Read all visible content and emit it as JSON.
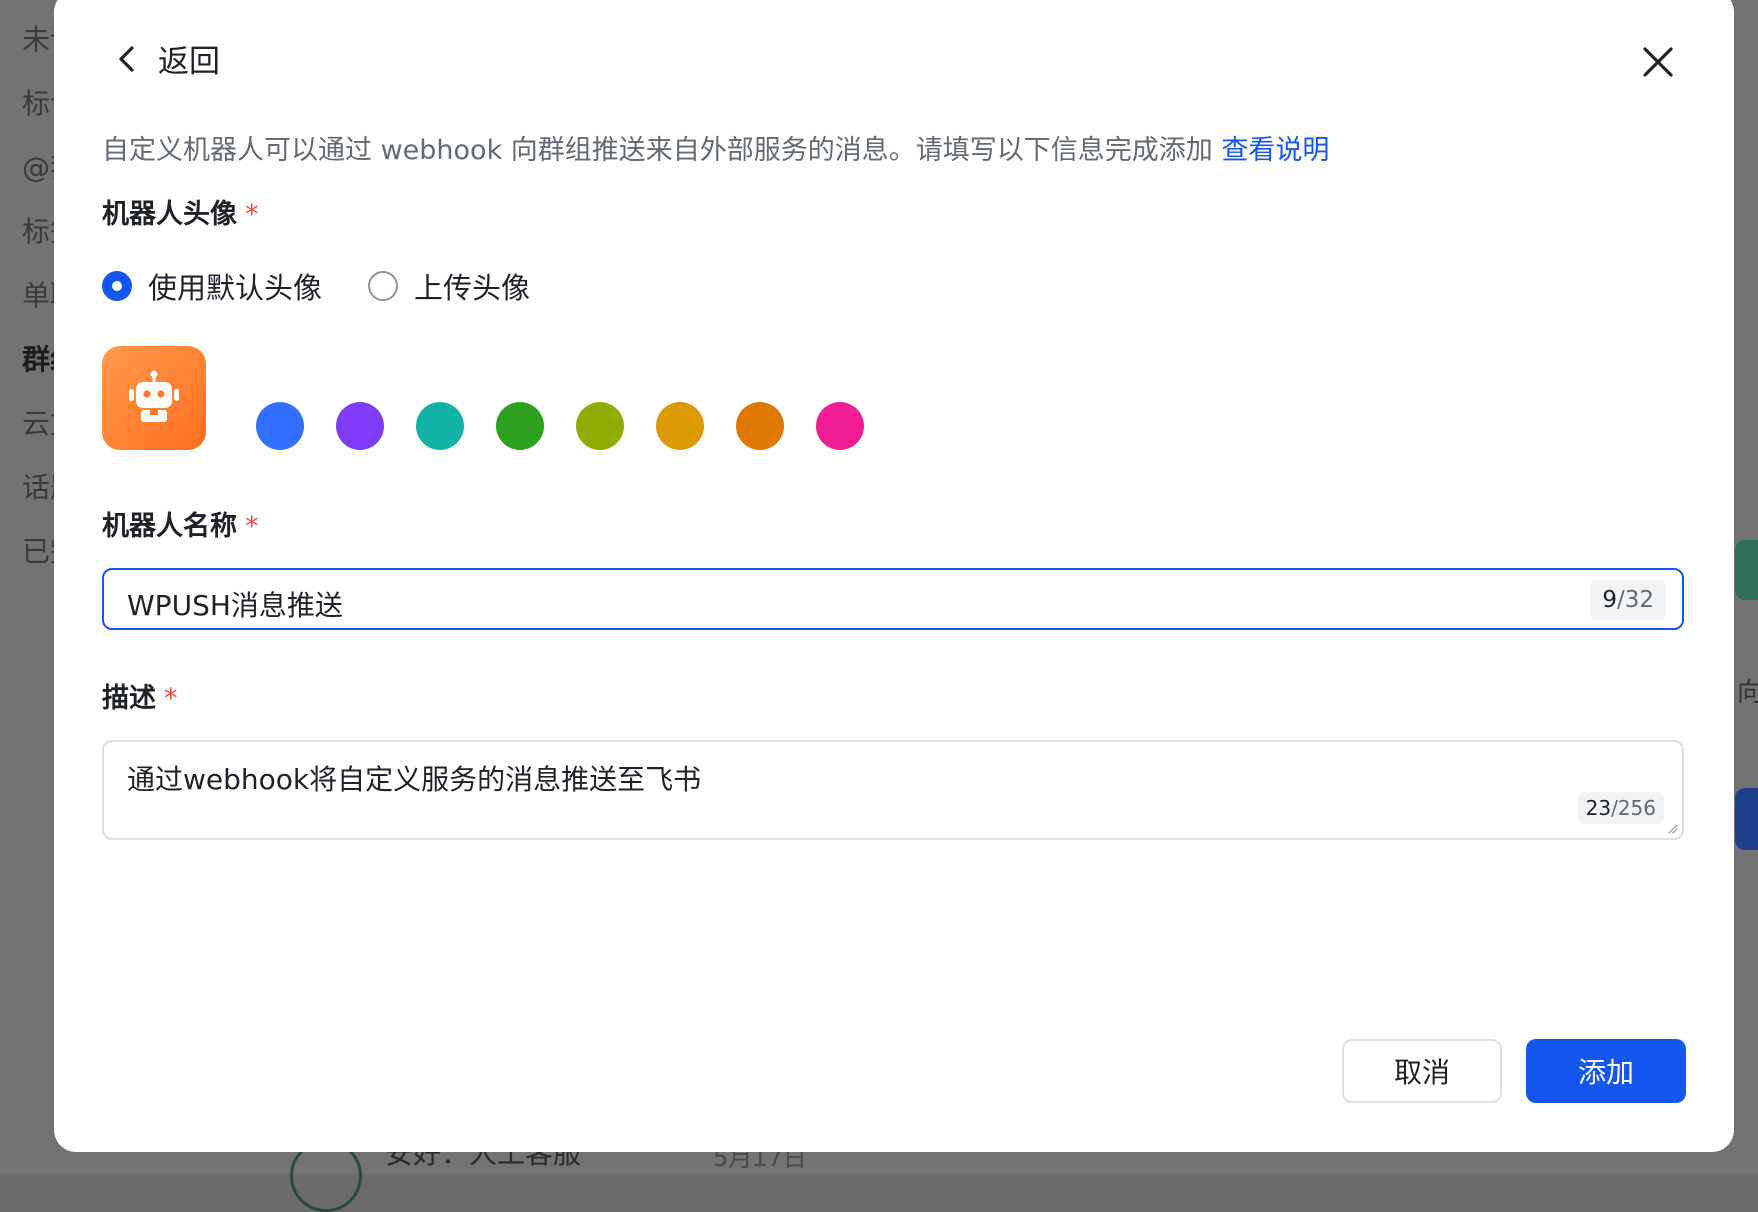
{
  "background": {
    "nav_items": [
      "未读",
      "标记",
      "@我",
      "标签",
      "单聊",
      "群组",
      "云文档",
      "话题",
      "已完成"
    ],
    "right_text": "向",
    "bottom_text": "安好：人工客服",
    "bottom_date": "5月17日"
  },
  "dialog": {
    "back_label": "返回",
    "intro_text": "自定义机器人可以通过 webhook 向群组推送来自外部服务的消息。请填写以下信息完成添加",
    "intro_link": "查看说明",
    "avatar_section": {
      "label": "机器人头像",
      "required_mark": "*",
      "options": [
        {
          "label": "使用默认头像",
          "checked": true
        },
        {
          "label": "上传头像",
          "checked": false
        }
      ],
      "current_avatar_color": "#ff7a2e",
      "avatar_icon": "robot-icon",
      "swatches": [
        "#3370ff",
        "#7f3bf5",
        "#10b3a3",
        "#2ea121",
        "#8fac02",
        "#dc9b04",
        "#de7802",
        "#f01d94"
      ]
    },
    "name_section": {
      "label": "机器人名称",
      "required_mark": "*",
      "value": "WPUSH消息推送",
      "count": "9",
      "max": "/32"
    },
    "desc_section": {
      "label": "描述",
      "required_mark": "*",
      "value": "通过webhook将自定义服务的消息推送至飞书",
      "count": "23",
      "max": "/256"
    },
    "buttons": {
      "cancel": "取消",
      "add": "添加"
    },
    "colors": {
      "primary": "#1456f0",
      "required": "#f54a45"
    }
  }
}
